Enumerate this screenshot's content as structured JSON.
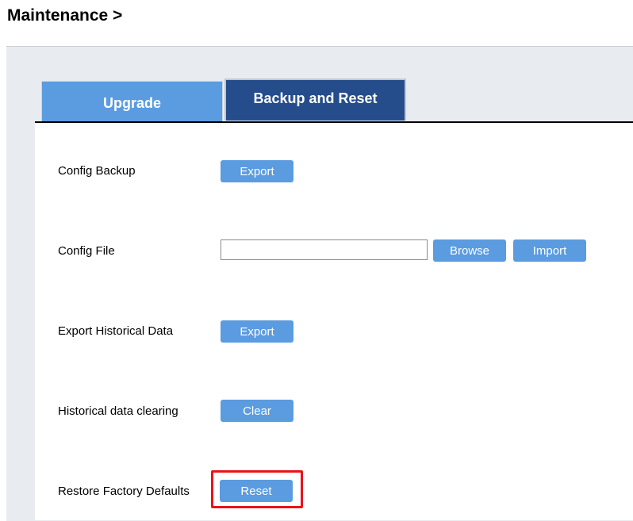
{
  "page": {
    "heading": "Maintenance >"
  },
  "tabs": [
    {
      "label": "Upgrade",
      "active": false
    },
    {
      "label": "Backup and Reset",
      "active": true
    }
  ],
  "rows": {
    "config_backup": {
      "label": "Config Backup",
      "button": "Export"
    },
    "config_file": {
      "label": "Config File",
      "input_value": "",
      "browse": "Browse",
      "import": "Import"
    },
    "export_historical": {
      "label": "Export Historical Data",
      "button": "Export"
    },
    "historical_clearing": {
      "label": "Historical data clearing",
      "button": "Clear"
    },
    "restore_defaults": {
      "label": "Restore Factory Defaults",
      "button": "Reset",
      "highlighted": true
    }
  },
  "colors": {
    "tab_inactive": "#5b9be0",
    "tab_active": "#254d8b",
    "button": "#5b9be0",
    "highlight": "#e8131b",
    "panel_bg": "#e8ecf0"
  }
}
